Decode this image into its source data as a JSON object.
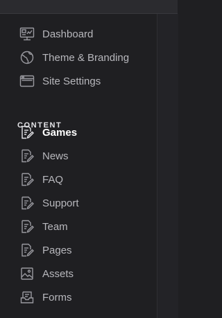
{
  "nav": {
    "top_items": [
      {
        "label": "Dashboard",
        "icon": "dashboard-icon"
      },
      {
        "label": "Theme & Branding",
        "icon": "globe-icon"
      },
      {
        "label": "Site Settings",
        "icon": "browser-window-icon"
      }
    ],
    "content_heading": "CONTENT",
    "content_items": [
      {
        "label": "Games",
        "icon": "document-edit-icon",
        "active": true
      },
      {
        "label": "News",
        "icon": "document-edit-icon"
      },
      {
        "label": "FAQ",
        "icon": "document-edit-icon"
      },
      {
        "label": "Support",
        "icon": "document-edit-icon"
      },
      {
        "label": "Team",
        "icon": "document-edit-icon"
      },
      {
        "label": "Pages",
        "icon": "document-edit-icon"
      },
      {
        "label": "Assets",
        "icon": "image-icon"
      },
      {
        "label": "Forms",
        "icon": "inbox-tray-icon"
      }
    ]
  },
  "colors": {
    "background": "#1f1f22",
    "text": "#b8b8bd",
    "active_text": "#ffffff",
    "icon": "#9a9aa0"
  }
}
